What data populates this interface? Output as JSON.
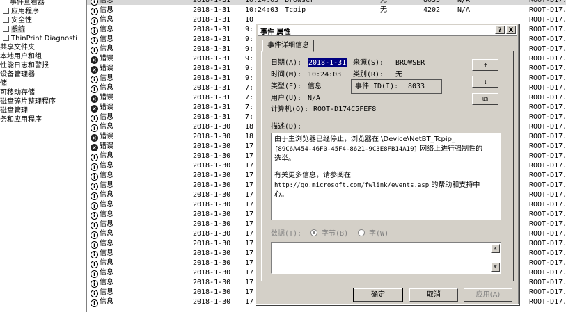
{
  "tree": [
    {
      "label": "事件查看器",
      "indent": 14,
      "icon": false,
      "selected": false
    },
    {
      "label": "应用程序",
      "indent": 4,
      "icon": true,
      "selected": false
    },
    {
      "label": "安全性",
      "indent": 4,
      "icon": true,
      "selected": false
    },
    {
      "label": "系统",
      "indent": 4,
      "icon": true,
      "selected": true
    },
    {
      "label": "ThinPrint Diagnosti",
      "indent": 4,
      "icon": true,
      "selected": false
    },
    {
      "label": "共享文件夹",
      "indent": 0,
      "icon": false,
      "selected": false
    },
    {
      "label": "本地用户和组",
      "indent": 0,
      "icon": false,
      "selected": false
    },
    {
      "label": "性能日志和警报",
      "indent": 0,
      "icon": false,
      "selected": false
    },
    {
      "label": "设备管理器",
      "indent": 0,
      "icon": false,
      "selected": false
    },
    {
      "label": "储",
      "indent": 0,
      "icon": false,
      "selected": false
    },
    {
      "label": "可移动存储",
      "indent": 0,
      "icon": false,
      "selected": false
    },
    {
      "label": "磁盘碎片整理程序",
      "indent": 0,
      "icon": false,
      "selected": false
    },
    {
      "label": "磁盘管理",
      "indent": 0,
      "icon": false,
      "selected": false
    },
    {
      "label": "务和应用程序",
      "indent": 0,
      "icon": false,
      "selected": false
    }
  ],
  "rows": [
    {
      "type": "信息",
      "kind": "info",
      "date": "2018-1-31",
      "time": "10:24:03",
      "source": "Browser",
      "category": "无",
      "id": "8033",
      "user": "N/A",
      "computer": "ROOT-D17...",
      "selected": true
    },
    {
      "type": "信息",
      "kind": "info",
      "date": "2018-1-31",
      "time": "10:24:03",
      "source": "Tcpip",
      "category": "无",
      "id": "4202",
      "user": "N/A",
      "computer": "ROOT-D17...",
      "selected": false
    },
    {
      "type": "信息",
      "kind": "info",
      "date": "2018-1-31",
      "time": "10",
      "source": "",
      "category": "",
      "id": "",
      "user": "",
      "computer": "ROOT-D17...",
      "selected": false
    },
    {
      "type": "信息",
      "kind": "info",
      "date": "2018-1-31",
      "time": "9:",
      "source": "",
      "category": "",
      "id": "",
      "user": "",
      "computer": "ROOT-D17...",
      "selected": false
    },
    {
      "type": "信息",
      "kind": "info",
      "date": "2018-1-31",
      "time": "9:",
      "source": "",
      "category": "",
      "id": "",
      "user": "",
      "computer": "ROOT-D17...",
      "selected": false
    },
    {
      "type": "信息",
      "kind": "info",
      "date": "2018-1-31",
      "time": "9:",
      "source": "",
      "category": "",
      "id": "",
      "user": "",
      "computer": "ROOT-D17...",
      "selected": false
    },
    {
      "type": "错误",
      "kind": "err",
      "date": "2018-1-31",
      "time": "9:",
      "source": "",
      "category": "",
      "id": "",
      "user": "",
      "computer": "ROOT-D17...",
      "selected": false
    },
    {
      "type": "错误",
      "kind": "err",
      "date": "2018-1-31",
      "time": "9:",
      "source": "",
      "category": "",
      "id": "",
      "user": "",
      "computer": "ROOT-D17...",
      "selected": false
    },
    {
      "type": "信息",
      "kind": "info",
      "date": "2018-1-31",
      "time": "9:",
      "source": "",
      "category": "",
      "id": "",
      "user": "",
      "computer": "ROOT-D17...",
      "selected": false
    },
    {
      "type": "信息",
      "kind": "info",
      "date": "2018-1-31",
      "time": "7:",
      "source": "",
      "category": "",
      "id": "",
      "user": "",
      "computer": "ROOT-D17...",
      "selected": false
    },
    {
      "type": "错误",
      "kind": "err",
      "date": "2018-1-31",
      "time": "7:",
      "source": "",
      "category": "",
      "id": "",
      "user": "",
      "computer": "ROOT-D17...",
      "selected": false
    },
    {
      "type": "错误",
      "kind": "err",
      "date": "2018-1-31",
      "time": "7:",
      "source": "",
      "category": "",
      "id": "",
      "user": "",
      "computer": "ROOT-D17...",
      "selected": false
    },
    {
      "type": "信息",
      "kind": "info",
      "date": "2018-1-31",
      "time": "7:",
      "source": "",
      "category": "",
      "id": "",
      "user": "",
      "computer": "ROOT-D17...",
      "selected": false
    },
    {
      "type": "信息",
      "kind": "info",
      "date": "2018-1-30",
      "time": "18",
      "source": "",
      "category": "",
      "id": "",
      "user": "",
      "computer": "ROOT-D17...",
      "selected": false
    },
    {
      "type": "错误",
      "kind": "err",
      "date": "2018-1-30",
      "time": "18",
      "source": "",
      "category": "",
      "id": "",
      "user": "",
      "computer": "ROOT-D17...",
      "selected": false
    },
    {
      "type": "错误",
      "kind": "err",
      "date": "2018-1-30",
      "time": "17",
      "source": "",
      "category": "",
      "id": "",
      "user": "",
      "computer": "ROOT-D17...",
      "selected": false
    },
    {
      "type": "信息",
      "kind": "info",
      "date": "2018-1-30",
      "time": "17",
      "source": "",
      "category": "",
      "id": "",
      "user": "",
      "computer": "ROOT-D17...",
      "selected": false
    },
    {
      "type": "信息",
      "kind": "info",
      "date": "2018-1-30",
      "time": "17",
      "source": "",
      "category": "",
      "id": "",
      "user": "",
      "computer": "ROOT-D17...",
      "selected": false
    },
    {
      "type": "信息",
      "kind": "info",
      "date": "2018-1-30",
      "time": "17",
      "source": "",
      "category": "",
      "id": "",
      "user": "",
      "computer": "ROOT-D17...",
      "selected": false
    },
    {
      "type": "信息",
      "kind": "info",
      "date": "2018-1-30",
      "time": "17",
      "source": "",
      "category": "",
      "id": "",
      "user": "",
      "computer": "ROOT-D17...",
      "selected": false
    },
    {
      "type": "信息",
      "kind": "info",
      "date": "2018-1-30",
      "time": "17",
      "source": "",
      "category": "",
      "id": "",
      "user": "",
      "computer": "ROOT-D17...",
      "selected": false
    },
    {
      "type": "信息",
      "kind": "info",
      "date": "2018-1-30",
      "time": "17",
      "source": "",
      "category": "",
      "id": "",
      "user": "",
      "computer": "ROOT-D17...",
      "selected": false
    },
    {
      "type": "信息",
      "kind": "info",
      "date": "2018-1-30",
      "time": "17",
      "source": "",
      "category": "",
      "id": "",
      "user": "",
      "computer": "ROOT-D17...",
      "selected": false
    },
    {
      "type": "信息",
      "kind": "info",
      "date": "2018-1-30",
      "time": "17",
      "source": "",
      "category": "",
      "id": "",
      "user": "",
      "computer": "ROOT-D17...",
      "selected": false
    },
    {
      "type": "信息",
      "kind": "info",
      "date": "2018-1-30",
      "time": "17",
      "source": "",
      "category": "",
      "id": "",
      "user": "",
      "computer": "ROOT-D17...",
      "selected": false
    },
    {
      "type": "信息",
      "kind": "info",
      "date": "2018-1-30",
      "time": "17",
      "source": "",
      "category": "",
      "id": "",
      "user": "",
      "computer": "ROOT-D17...",
      "selected": false
    },
    {
      "type": "信息",
      "kind": "info",
      "date": "2018-1-30",
      "time": "17",
      "source": "",
      "category": "",
      "id": "",
      "user": "",
      "computer": "ROOT-D17...",
      "selected": false
    },
    {
      "type": "信息",
      "kind": "info",
      "date": "2018-1-30",
      "time": "17",
      "source": "",
      "category": "",
      "id": "",
      "user": "",
      "computer": "ROOT-D17...",
      "selected": false
    },
    {
      "type": "信息",
      "kind": "info",
      "date": "2018-1-30",
      "time": "17",
      "source": "",
      "category": "",
      "id": "",
      "user": "",
      "computer": "ROOT-D17...",
      "selected": false
    },
    {
      "type": "信息",
      "kind": "info",
      "date": "2018-1-30",
      "time": "17",
      "source": "",
      "category": "",
      "id": "",
      "user": "",
      "computer": "ROOT-D17...",
      "selected": false
    },
    {
      "type": "信息",
      "kind": "info",
      "date": "2018-1-30",
      "time": "17",
      "source": "",
      "category": "",
      "id": "",
      "user": "",
      "computer": "ROOT-D17...",
      "selected": false
    },
    {
      "type": "信息",
      "kind": "info",
      "date": "2018-1-30",
      "time": "17",
      "source": "",
      "category": "",
      "id": "",
      "user": "",
      "computer": "ROOT-D17...",
      "selected": false
    }
  ],
  "dialog": {
    "title": "事件 属性",
    "help_btn": "?",
    "close_btn": "X",
    "tab": "事件详细信息",
    "date_label": "日期(A):",
    "date_value": "2018-1-31",
    "source_label": "来源(S):",
    "source_value": "BROWSER",
    "time_label": "时间(M):",
    "time_value": "10:24:03",
    "category_label": "类别(R):",
    "category_value": "无",
    "type_label": "类型(E):",
    "type_value": "信息",
    "eventid_label": "事件 ID(I):",
    "eventid_value": "8033",
    "user_label": "用户(U):",
    "user_value": "N/A",
    "computer_label": "计算机(O):",
    "computer_value": "ROOT-D174C5FEF8",
    "desc_label": "描述(D):",
    "desc_line1": "由于主浏览器已经停止，浏览器在 \\Device\\NetBT_Tcpip_",
    "desc_line2a": "{89C6A454-46F0-45F4-8621-9C3E8FB14A10}",
    "desc_line2b": " 网络上进行强制性的",
    "desc_line3": "选举。",
    "desc_line4": "有关更多信息，请参阅在",
    "desc_link": "http://go.microsoft.com/fwlink/events.asp",
    "desc_line5": " 的帮助和支持中",
    "desc_line6": "心。",
    "data_label": "数据(T):",
    "bytes_label": "字节(B)",
    "words_label": "字(W)",
    "ok": "确定",
    "cancel": "取消",
    "apply": "应用(A)",
    "up_icon": "↑",
    "down_icon": "↓",
    "copy_icon": "⧉"
  }
}
